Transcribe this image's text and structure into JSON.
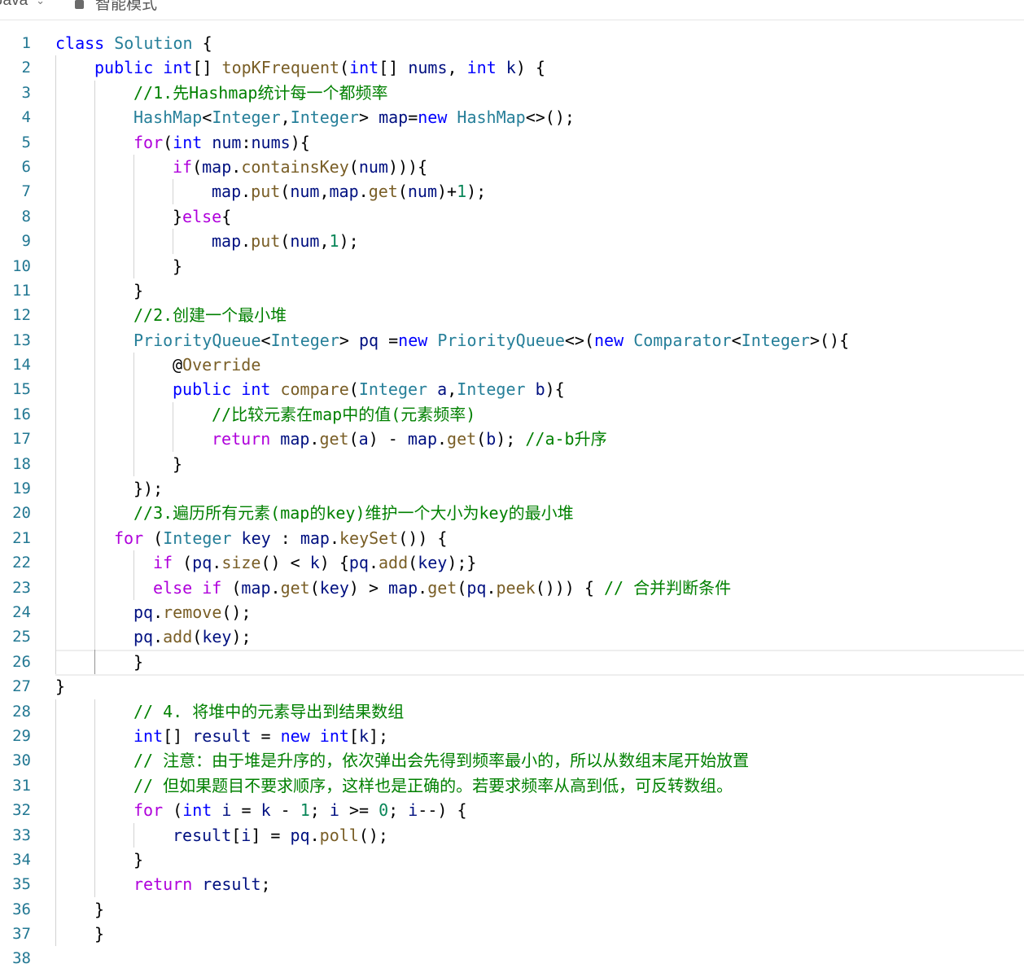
{
  "toolbar": {
    "language": "Java",
    "mode_label": "智能模式"
  },
  "editor": {
    "current_line": 26,
    "lines": [
      {
        "n": "1",
        "indent": 0,
        "guides": [],
        "tokens": [
          [
            "kw",
            "class "
          ],
          [
            "ty",
            "Solution"
          ],
          [
            "op",
            " {"
          ]
        ]
      },
      {
        "n": "2",
        "indent": 1,
        "guides": [
          68
        ],
        "tokens": [
          [
            "kw",
            "public "
          ],
          [
            "kw",
            "int"
          ],
          [
            "op",
            "[] "
          ],
          [
            "fn",
            "topKFrequent"
          ],
          [
            "op",
            "("
          ],
          [
            "kw",
            "int"
          ],
          [
            "op",
            "[] "
          ],
          [
            "vr",
            "nums"
          ],
          [
            "op",
            ", "
          ],
          [
            "kw",
            "int "
          ],
          [
            "vr",
            "k"
          ],
          [
            "op",
            ") {"
          ]
        ]
      },
      {
        "n": "3",
        "indent": 2,
        "guides": [
          68,
          116
        ],
        "tokens": [
          [
            "cm",
            "//1.先Hashmap统计每一个都频率"
          ]
        ]
      },
      {
        "n": "4",
        "indent": 2,
        "guides": [
          68,
          116
        ],
        "tokens": [
          [
            "ty",
            "HashMap"
          ],
          [
            "op",
            "<"
          ],
          [
            "ty",
            "Integer"
          ],
          [
            "op",
            ","
          ],
          [
            "ty",
            "Integer"
          ],
          [
            "op",
            "> "
          ],
          [
            "vr",
            "map"
          ],
          [
            "op",
            "="
          ],
          [
            "kw",
            "new "
          ],
          [
            "ty",
            "HashMap"
          ],
          [
            "op",
            "<>();"
          ]
        ]
      },
      {
        "n": "5",
        "indent": 2,
        "guides": [
          68,
          116
        ],
        "tokens": [
          [
            "kc",
            "for"
          ],
          [
            "op",
            "("
          ],
          [
            "kw",
            "int "
          ],
          [
            "vr",
            "num"
          ],
          [
            "op",
            ":"
          ],
          [
            "vr",
            "nums"
          ],
          [
            "op",
            "){"
          ]
        ]
      },
      {
        "n": "6",
        "indent": 3,
        "guides": [
          68,
          116,
          164
        ],
        "tokens": [
          [
            "kc",
            "if"
          ],
          [
            "op",
            "("
          ],
          [
            "vr",
            "map"
          ],
          [
            "op",
            "."
          ],
          [
            "fn",
            "containsKey"
          ],
          [
            "op",
            "("
          ],
          [
            "vr",
            "num"
          ],
          [
            "op",
            "))){"
          ]
        ]
      },
      {
        "n": "7",
        "indent": 4,
        "guides": [
          68,
          116,
          164,
          212
        ],
        "tokens": [
          [
            "vr",
            "map"
          ],
          [
            "op",
            "."
          ],
          [
            "fn",
            "put"
          ],
          [
            "op",
            "("
          ],
          [
            "vr",
            "num"
          ],
          [
            "op",
            ","
          ],
          [
            "vr",
            "map"
          ],
          [
            "op",
            "."
          ],
          [
            "fn",
            "get"
          ],
          [
            "op",
            "("
          ],
          [
            "vr",
            "num"
          ],
          [
            "op",
            ")+"
          ],
          [
            "nm",
            "1"
          ],
          [
            "op",
            ");"
          ]
        ]
      },
      {
        "n": "8",
        "indent": 3,
        "guides": [
          68,
          116,
          164
        ],
        "tokens": [
          [
            "op",
            "}"
          ],
          [
            "kc",
            "else"
          ],
          [
            "op",
            "{"
          ]
        ]
      },
      {
        "n": "9",
        "indent": 4,
        "guides": [
          68,
          116,
          164,
          212
        ],
        "tokens": [
          [
            "vr",
            "map"
          ],
          [
            "op",
            "."
          ],
          [
            "fn",
            "put"
          ],
          [
            "op",
            "("
          ],
          [
            "vr",
            "num"
          ],
          [
            "op",
            ","
          ],
          [
            "nm",
            "1"
          ],
          [
            "op",
            ");"
          ]
        ]
      },
      {
        "n": "10",
        "indent": 3,
        "guides": [
          68,
          116,
          164
        ],
        "tokens": [
          [
            "op",
            "}"
          ]
        ]
      },
      {
        "n": "11",
        "indent": 2,
        "guides": [
          68,
          116
        ],
        "tokens": [
          [
            "op",
            "}"
          ]
        ]
      },
      {
        "n": "12",
        "indent": 2,
        "guides": [
          68,
          116
        ],
        "tokens": [
          [
            "cm",
            "//2.创建一个最小堆"
          ]
        ]
      },
      {
        "n": "13",
        "indent": 2,
        "guides": [
          68,
          116
        ],
        "tokens": [
          [
            "ty",
            "PriorityQueue"
          ],
          [
            "op",
            "<"
          ],
          [
            "ty",
            "Integer"
          ],
          [
            "op",
            "> "
          ],
          [
            "vr",
            "pq"
          ],
          [
            "op",
            " ="
          ],
          [
            "kw",
            "new "
          ],
          [
            "ty",
            "PriorityQueue"
          ],
          [
            "op",
            "<>("
          ],
          [
            "kw",
            "new "
          ],
          [
            "ty",
            "Comparator"
          ],
          [
            "op",
            "<"
          ],
          [
            "ty",
            "Integer"
          ],
          [
            "op",
            ">(){"
          ]
        ]
      },
      {
        "n": "14",
        "indent": 3,
        "guides": [
          68,
          116,
          164
        ],
        "tokens": [
          [
            "op",
            "@"
          ],
          [
            "an",
            "Override"
          ]
        ]
      },
      {
        "n": "15",
        "indent": 3,
        "guides": [
          68,
          116,
          164
        ],
        "tokens": [
          [
            "kw",
            "public "
          ],
          [
            "kw",
            "int "
          ],
          [
            "fn",
            "compare"
          ],
          [
            "op",
            "("
          ],
          [
            "ty",
            "Integer "
          ],
          [
            "vr",
            "a"
          ],
          [
            "op",
            ","
          ],
          [
            "ty",
            "Integer "
          ],
          [
            "vr",
            "b"
          ],
          [
            "op",
            "){"
          ]
        ]
      },
      {
        "n": "16",
        "indent": 4,
        "guides": [
          68,
          116,
          164,
          212
        ],
        "tokens": [
          [
            "cm",
            "//比较元素在map中的值(元素频率)"
          ]
        ]
      },
      {
        "n": "17",
        "indent": 4,
        "guides": [
          68,
          116,
          164,
          212
        ],
        "tokens": [
          [
            "kc",
            "return "
          ],
          [
            "vr",
            "map"
          ],
          [
            "op",
            "."
          ],
          [
            "fn",
            "get"
          ],
          [
            "op",
            "("
          ],
          [
            "vr",
            "a"
          ],
          [
            "op",
            ") - "
          ],
          [
            "vr",
            "map"
          ],
          [
            "op",
            "."
          ],
          [
            "fn",
            "get"
          ],
          [
            "op",
            "("
          ],
          [
            "vr",
            "b"
          ],
          [
            "op",
            "); "
          ],
          [
            "cm",
            "//a-b升序"
          ]
        ]
      },
      {
        "n": "18",
        "indent": 3,
        "guides": [
          68,
          116,
          164
        ],
        "tokens": [
          [
            "op",
            "}"
          ]
        ]
      },
      {
        "n": "19",
        "indent": 2,
        "guides": [
          68,
          116
        ],
        "tokens": [
          [
            "op",
            "});"
          ]
        ]
      },
      {
        "n": "20",
        "indent": 2,
        "guides": [
          68,
          116
        ],
        "tokens": [
          [
            "cm",
            "//3.遍历所有元素(map的key)维护一个大小为key的最小堆"
          ]
        ]
      },
      {
        "n": "21",
        "indent": 1.5,
        "guides": [
          68,
          116
        ],
        "tokens": [
          [
            "kc",
            "for "
          ],
          [
            "op",
            "("
          ],
          [
            "ty",
            "Integer "
          ],
          [
            "vr",
            "key "
          ],
          [
            "op",
            ": "
          ],
          [
            "vr",
            "map"
          ],
          [
            "op",
            "."
          ],
          [
            "fn",
            "keySet"
          ],
          [
            "op",
            "()) {"
          ]
        ]
      },
      {
        "n": "22",
        "indent": 2.5,
        "guides": [
          68,
          116,
          164
        ],
        "tokens": [
          [
            "kc",
            "if "
          ],
          [
            "op",
            "("
          ],
          [
            "vr",
            "pq"
          ],
          [
            "op",
            "."
          ],
          [
            "fn",
            "size"
          ],
          [
            "op",
            "() < "
          ],
          [
            "vr",
            "k"
          ],
          [
            "op",
            ") {"
          ],
          [
            "vr",
            "pq"
          ],
          [
            "op",
            "."
          ],
          [
            "fn",
            "add"
          ],
          [
            "op",
            "("
          ],
          [
            "vr",
            "key"
          ],
          [
            "op",
            ");}"
          ]
        ]
      },
      {
        "n": "23",
        "indent": 2.5,
        "guides": [
          68,
          116,
          164
        ],
        "tokens": [
          [
            "kc",
            "else "
          ],
          [
            "kc",
            "if "
          ],
          [
            "op",
            "("
          ],
          [
            "vr",
            "map"
          ],
          [
            "op",
            "."
          ],
          [
            "fn",
            "get"
          ],
          [
            "op",
            "("
          ],
          [
            "vr",
            "key"
          ],
          [
            "op",
            ") > "
          ],
          [
            "vr",
            "map"
          ],
          [
            "op",
            "."
          ],
          [
            "fn",
            "get"
          ],
          [
            "op",
            "("
          ],
          [
            "vr",
            "pq"
          ],
          [
            "op",
            "."
          ],
          [
            "fn",
            "peek"
          ],
          [
            "op",
            "())) { "
          ],
          [
            "cm",
            "// 合并判断条件"
          ]
        ]
      },
      {
        "n": "24",
        "indent": 2,
        "guides": [
          68,
          116
        ],
        "tokens": [
          [
            "vr",
            "pq"
          ],
          [
            "op",
            "."
          ],
          [
            "fn",
            "remove"
          ],
          [
            "op",
            "();"
          ]
        ]
      },
      {
        "n": "25",
        "indent": 2,
        "guides": [
          68,
          116
        ],
        "tokens": [
          [
            "vr",
            "pq"
          ],
          [
            "op",
            "."
          ],
          [
            "fn",
            "add"
          ],
          [
            "op",
            "("
          ],
          [
            "vr",
            "key"
          ],
          [
            "op",
            ");"
          ]
        ]
      },
      {
        "n": "26",
        "indent": 2,
        "guides": [
          68,
          116
        ],
        "dark": true,
        "tokens": [
          [
            "op",
            "}"
          ]
        ]
      },
      {
        "n": "27",
        "indent": 0,
        "guides": [],
        "tokens": [
          [
            "op",
            "}"
          ]
        ]
      },
      {
        "n": "28",
        "indent": 2,
        "guides": [
          68,
          116
        ],
        "tokens": [
          [
            "cm",
            "// 4. 将堆中的元素导出到结果数组"
          ]
        ]
      },
      {
        "n": "29",
        "indent": 2,
        "guides": [
          68,
          116
        ],
        "tokens": [
          [
            "kw",
            "int"
          ],
          [
            "op",
            "[] "
          ],
          [
            "vr",
            "result"
          ],
          [
            "op",
            " = "
          ],
          [
            "kw",
            "new "
          ],
          [
            "kw",
            "int"
          ],
          [
            "op",
            "["
          ],
          [
            "vr",
            "k"
          ],
          [
            "op",
            "];"
          ]
        ]
      },
      {
        "n": "30",
        "indent": 2,
        "guides": [
          68,
          116
        ],
        "tokens": [
          [
            "cm",
            "// 注意：由于堆是升序的，依次弹出会先得到频率最小的，所以从数组末尾开始放置"
          ]
        ]
      },
      {
        "n": "31",
        "indent": 2,
        "guides": [
          68,
          116
        ],
        "tokens": [
          [
            "cm",
            "// 但如果题目不要求顺序，这样也是正确的。若要求频率从高到低，可反转数组。"
          ]
        ]
      },
      {
        "n": "32",
        "indent": 2,
        "guides": [
          68,
          116
        ],
        "tokens": [
          [
            "kc",
            "for "
          ],
          [
            "op",
            "("
          ],
          [
            "kw",
            "int "
          ],
          [
            "vr",
            "i"
          ],
          [
            "op",
            " = "
          ],
          [
            "vr",
            "k"
          ],
          [
            "op",
            " - "
          ],
          [
            "nm",
            "1"
          ],
          [
            "op",
            "; "
          ],
          [
            "vr",
            "i"
          ],
          [
            "op",
            " >= "
          ],
          [
            "nm",
            "0"
          ],
          [
            "op",
            "; "
          ],
          [
            "vr",
            "i"
          ],
          [
            "op",
            "--) {"
          ]
        ]
      },
      {
        "n": "33",
        "indent": 3,
        "guides": [
          68,
          116,
          164
        ],
        "tokens": [
          [
            "vr",
            "result"
          ],
          [
            "op",
            "["
          ],
          [
            "vr",
            "i"
          ],
          [
            "op",
            "] = "
          ],
          [
            "vr",
            "pq"
          ],
          [
            "op",
            "."
          ],
          [
            "fn",
            "poll"
          ],
          [
            "op",
            "();"
          ]
        ]
      },
      {
        "n": "34",
        "indent": 2,
        "guides": [
          68,
          116
        ],
        "tokens": [
          [
            "op",
            "}"
          ]
        ]
      },
      {
        "n": "35",
        "indent": 2,
        "guides": [
          68,
          116
        ],
        "tokens": [
          [
            "kc",
            "return "
          ],
          [
            "vr",
            "result"
          ],
          [
            "op",
            ";"
          ]
        ]
      },
      {
        "n": "36",
        "indent": 1,
        "guides": [
          68
        ],
        "tokens": [
          [
            "op",
            "}"
          ]
        ]
      },
      {
        "n": "37",
        "indent": 1,
        "guides": [
          68
        ],
        "tokens": [
          [
            "op",
            "}"
          ]
        ]
      },
      {
        "n": "38",
        "indent": 0,
        "guides": [],
        "tokens": []
      }
    ]
  }
}
